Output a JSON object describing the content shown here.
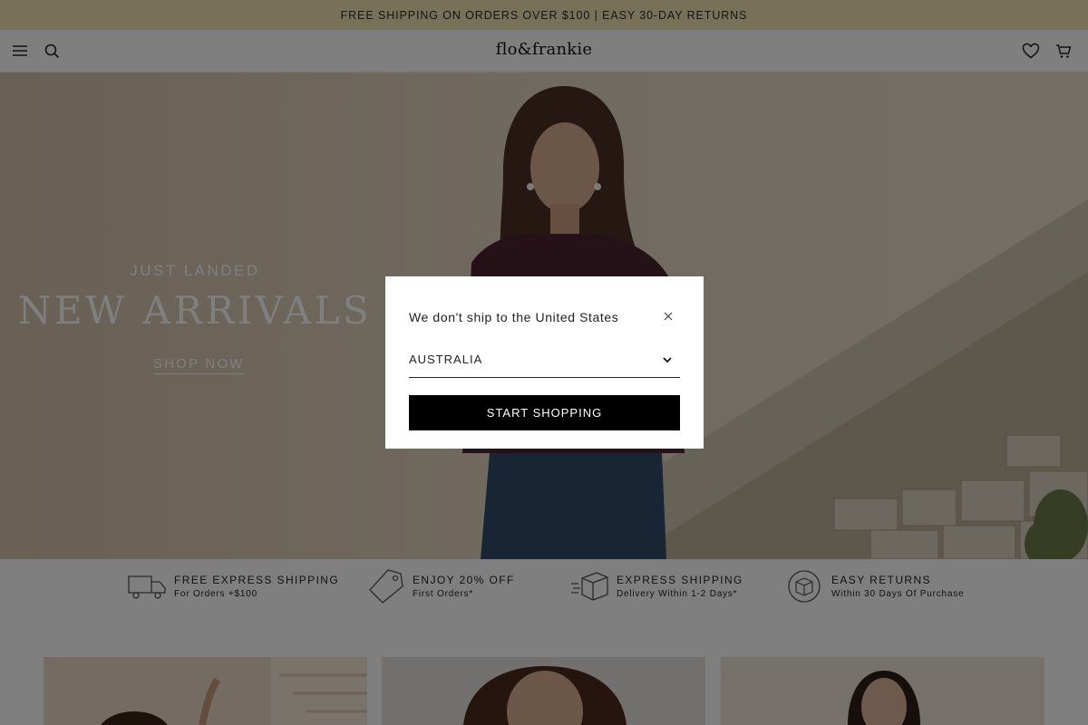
{
  "announcement": "FREE SHIPPING ON ORDERS OVER $100 | EASY 30-DAY RETURNS",
  "header": {
    "logo_text": "flo&frankie",
    "icons": [
      "menu-icon",
      "search-icon",
      "heart-icon",
      "cart-icon"
    ]
  },
  "hero": {
    "eyebrow": "JUST LANDED",
    "headline": "NEW ARRIVALS",
    "cta": "SHOP NOW"
  },
  "usps": [
    {
      "title": "FREE EXPRESS SHIPPING",
      "subtitle": "For Orders +$100",
      "icon": "truck-icon"
    },
    {
      "title": "ENJOY 20% OFF",
      "subtitle": "First Orders*",
      "icon": "tag-icon"
    },
    {
      "title": "EXPRESS SHIPPING",
      "subtitle": "Delivery Within 1-2 Days*",
      "icon": "box-icon"
    },
    {
      "title": "EASY RETURNS",
      "subtitle": "Within 30 Days Of Purchase",
      "icon": "return-box-icon"
    }
  ],
  "modal": {
    "message": "We don't ship to the United States",
    "country_value": "AUSTRALIA",
    "button": "START SHOPPING"
  },
  "colors": {
    "announcement_bg": "#efe2b4",
    "button_bg": "#000000",
    "overlay": "rgba(0,0,0,0.5)"
  }
}
